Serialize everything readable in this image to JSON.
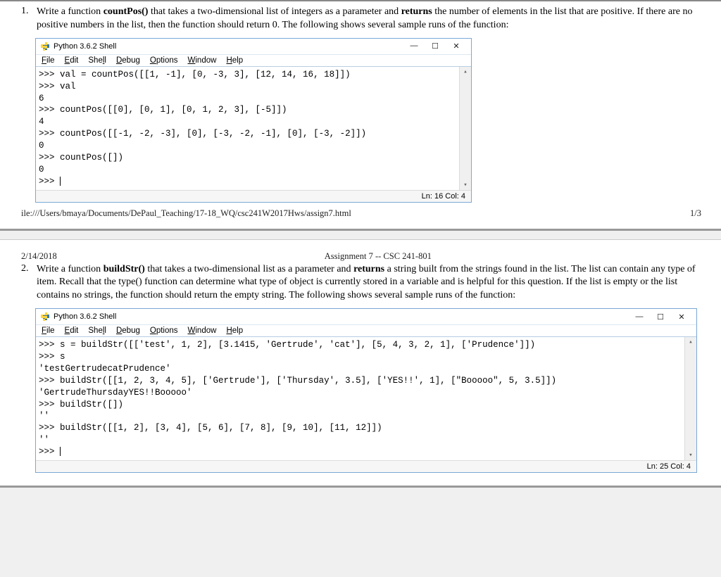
{
  "q1": {
    "num": "1.",
    "text_1": "Write a function ",
    "fn": "countPos()",
    "text_2": " that takes a two-dimensional list of integers as a parameter and ",
    "ret": "returns",
    "text_3": " the number of elements in the list that are positive. If there are no positive numbers in the list, then the function should return 0. The following shows several sample runs of the function:"
  },
  "q2": {
    "num": "2.",
    "text_1": "Write a function ",
    "fn": "buildStr()",
    "text_2": " that takes a two-dimensional list as a parameter and ",
    "ret": "returns",
    "text_3": " a string built from the strings found in the list. The list can contain any type of item. Recall that the type() function can determine what type of object is currently stored in a variable and is helpful for this question. If the list is empty or the list contains no strings, the function should return the empty string. The following shows several sample runs of the function:"
  },
  "shell": {
    "title": "Python 3.6.2 Shell",
    "menu": {
      "file": "File",
      "file_u": "F",
      "edit": "Edit",
      "edit_u": "E",
      "shell": "Shell",
      "shell_u": "l",
      "debug": "Debug",
      "debug_u": "D",
      "options": "Options",
      "options_u": "O",
      "window": "Window",
      "window_u": "W",
      "help": "Help",
      "help_u": "H"
    },
    "controls": {
      "min": "—",
      "max": "☐",
      "close": "✕"
    }
  },
  "shell1": {
    "lines": ">>> val = countPos([[1, -1], [0, -3, 3], [12, 14, 16, 18]])\n>>> val\n6\n>>> countPos([[0], [0, 1], [0, 1, 2, 3], [-5]])\n4\n>>> countPos([[-1, -2, -3], [0], [-3, -2, -1], [0], [-3, -2]])\n0\n>>> countPos([])\n0\n>>> ",
    "status": "Ln: 16  Col: 4"
  },
  "shell2": {
    "lines": ">>> s = buildStr([['test', 1, 2], [3.1415, 'Gertrude', 'cat'], [5, 4, 3, 2, 1], ['Prudence']])\n>>> s\n'testGertrudecatPrudence'\n>>> buildStr([[1, 2, 3, 4, 5], ['Gertrude'], ['Thursday', 3.5], ['YES!!', 1], [\"Booooo\", 5, 3.5]])\n'GertrudeThursdayYES!!Booooo'\n>>> buildStr([])\n''\n>>> buildStr([[1, 2], [3, 4], [5, 6], [7, 8], [9, 10], [11, 12]])\n''\n>>> ",
    "status": "Ln: 25  Col: 4"
  },
  "footer": {
    "path": "ile:///Users/bmaya/Documents/DePaul_Teaching/17-18_WQ/csc241W2017Hws/assign7.html",
    "page": "1/3"
  },
  "header": {
    "date": "2/14/2018",
    "title": "Assignment 7 -- CSC 241-801"
  }
}
